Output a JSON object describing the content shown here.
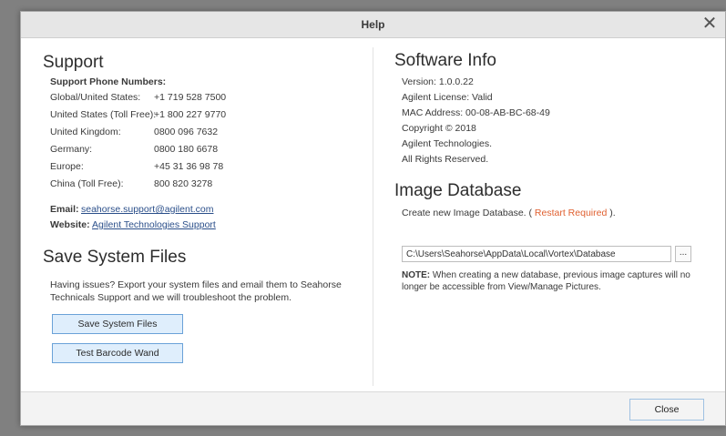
{
  "dialog": {
    "title": "Help",
    "close_icon": "close-icon"
  },
  "support": {
    "heading": "Support",
    "phone_heading": "Support Phone Numbers:",
    "phones": [
      {
        "label": "Global/United States:",
        "number": "+1 719 528 7500"
      },
      {
        "label": "United States (Toll Free):",
        "number": "+1 800 227 9770"
      },
      {
        "label": "United Kingdom:",
        "number": "0800 096 7632"
      },
      {
        "label": "Germany:",
        "number": "0800 180 6678"
      },
      {
        "label": "Europe:",
        "number": "+45 31 36 98 78"
      },
      {
        "label": "China (Toll Free):",
        "number": "800 820 3278"
      }
    ],
    "email_label": "Email:",
    "email_value": "seahorse.support@agilent.com",
    "website_label": "Website:",
    "website_value": "Agilent Technologies Support"
  },
  "save_files": {
    "heading": "Save System Files",
    "description": "Having issues? Export your system files and email them to Seahorse Technicals Support and we will troubleshoot the problem.",
    "save_button": "Save System Files",
    "barcode_button": "Test Barcode Wand"
  },
  "software_info": {
    "heading": "Software Info",
    "lines": [
      "Version: 1.0.0.22",
      "Agilent License: Valid",
      "MAC Address: 00-08-AB-BC-68-49",
      "Copyright © 2018",
      "Agilent Technologies.",
      "All Rights Reserved."
    ]
  },
  "image_database": {
    "heading": "Image Database",
    "create_prefix": "Create new Image Database. (",
    "restart_required": "Restart Required",
    "create_suffix": ").",
    "path_value": "C:\\Users\\Seahorse\\AppData\\Local\\Vortex\\Database",
    "browse_label": "...",
    "note_label": "NOTE:",
    "note_text": "When creating a new database, previous image captures will no longer be accessible from View/Manage Pictures."
  },
  "footer": {
    "close_button": "Close"
  },
  "colors": {
    "accent": "#e06030",
    "button_bg": "#dfeefc",
    "button_border": "#6aa2d8"
  }
}
